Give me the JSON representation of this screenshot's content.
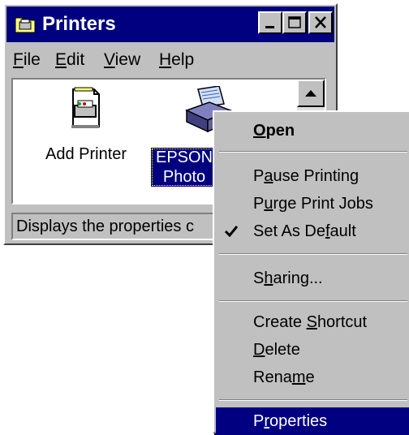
{
  "window": {
    "title": "Printers"
  },
  "menubar": {
    "items": [
      {
        "label": "File",
        "accel": "F",
        "rest": "ile"
      },
      {
        "label": "Edit",
        "accel": "E",
        "rest": "dit"
      },
      {
        "label": "View",
        "accel": "V",
        "rest": "iew"
      },
      {
        "label": "Help",
        "accel": "H",
        "rest": "elp"
      }
    ]
  },
  "files": [
    {
      "label": "Add Printer",
      "icon": "add-printer-icon"
    },
    {
      "label_line1": "EPSON",
      "label_line2": "Photo",
      "icon": "epson-printer-icon",
      "selected": true
    }
  ],
  "statusbar": {
    "text": "Displays the properties c"
  },
  "context_menu": {
    "items": [
      {
        "pre": "",
        "accel": "O",
        "post": "pen",
        "label": "Open",
        "default": true
      },
      {
        "pre": "P",
        "accel": "a",
        "post": "use Printing",
        "label": "Pause Printing"
      },
      {
        "pre": "P",
        "accel": "u",
        "post": "rge Print Jobs",
        "label": "Purge Print Jobs"
      },
      {
        "pre": "Set As De",
        "accel": "f",
        "post": "ault",
        "label": "Set As Default",
        "checked": true
      },
      {
        "pre": "S",
        "accel": "h",
        "post": "aring...",
        "label": "Sharing..."
      },
      {
        "pre": "Create ",
        "accel": "S",
        "post": "hortcut",
        "label": "Create Shortcut"
      },
      {
        "pre": "",
        "accel": "D",
        "post": "elete",
        "label": "Delete"
      },
      {
        "pre": "Rena",
        "accel": "m",
        "post": "e",
        "label": "Rename"
      },
      {
        "pre": "P",
        "accel": "r",
        "post": "operties",
        "label": "Properties",
        "highlighted": true
      }
    ]
  },
  "colors": {
    "titlebar": "#000080",
    "face": "#c0c0c0",
    "highlight": "#000080"
  }
}
